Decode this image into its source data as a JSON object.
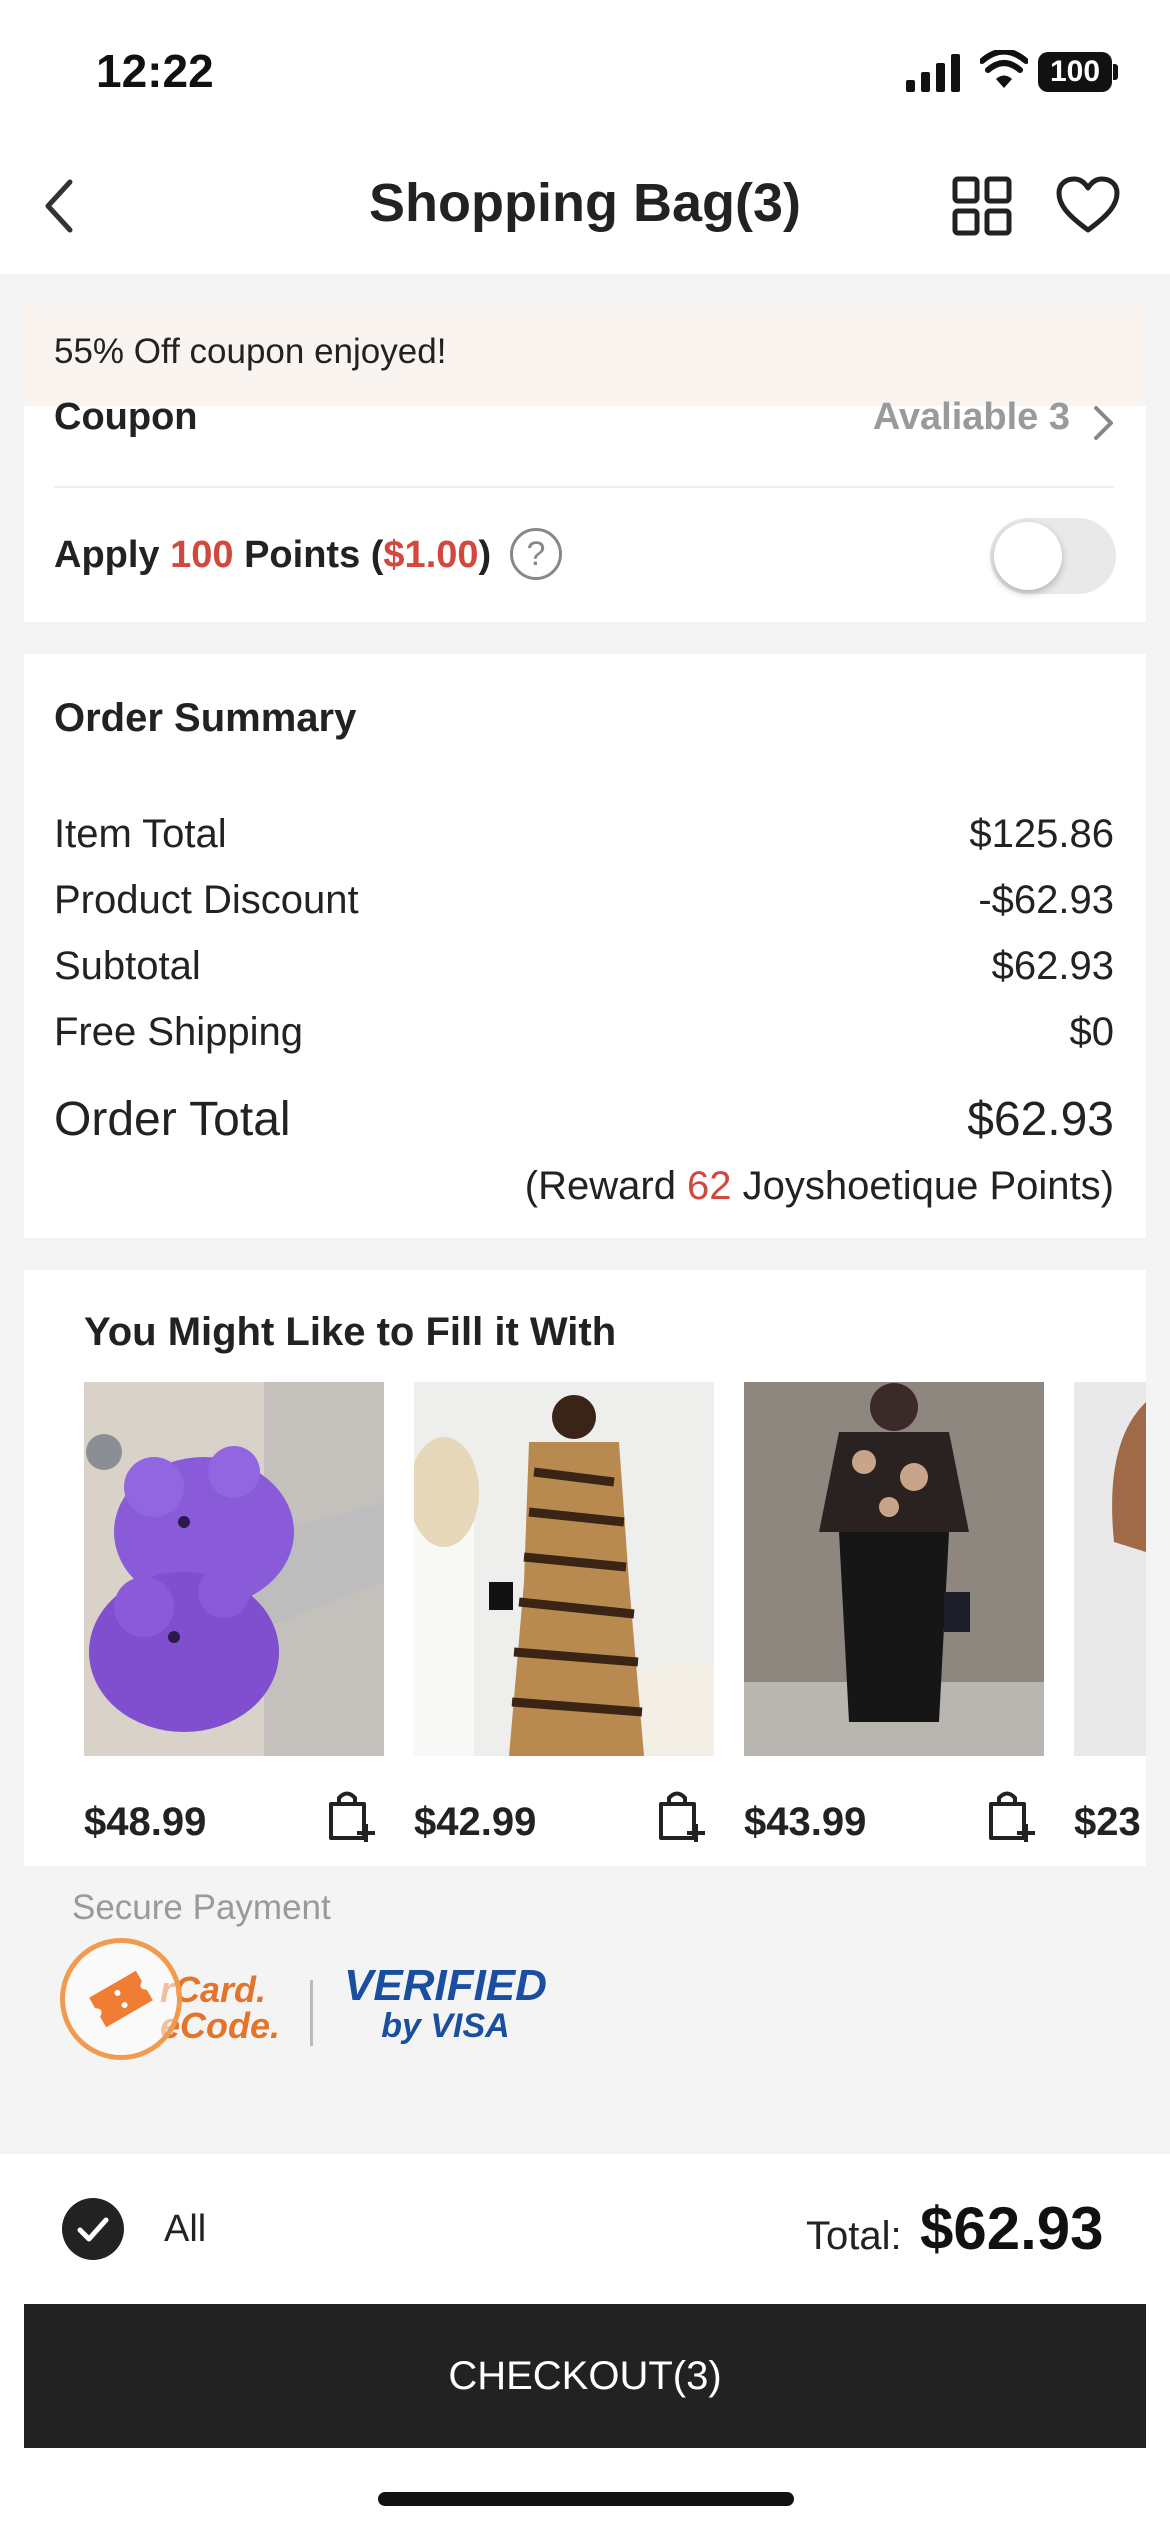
{
  "status": {
    "time": "12:22",
    "battery": "100"
  },
  "header": {
    "title": "Shopping Bag(3)"
  },
  "coupon_card": {
    "banner": "55% Off coupon enjoyed!",
    "coupon_label": "Coupon",
    "coupon_value": "Avaliable 3",
    "points": {
      "pre": "Apply ",
      "amount": "100",
      "mid": " Points (",
      "money": "$1.00",
      "post": ")"
    },
    "help": "?"
  },
  "summary": {
    "title": "Order Summary",
    "rows": [
      {
        "label": "Item Total",
        "value": "$125.86"
      },
      {
        "label": "Product Discount",
        "value": "-$62.93"
      },
      {
        "label": "Subtotal",
        "value": "$62.93"
      },
      {
        "label": "Free Shipping",
        "value": "$0"
      }
    ],
    "total_label": "Order Total",
    "total_value": "$62.93",
    "reward": {
      "pre": "(Reward ",
      "points": "62",
      "post": " Joyshoetique Points)"
    }
  },
  "suggestions": {
    "title": "You Might Like to Fill it With",
    "items": [
      {
        "price": "$48.99"
      },
      {
        "price": "$42.99"
      },
      {
        "price": "$43.99"
      },
      {
        "price": "$23"
      }
    ]
  },
  "secure": {
    "label": "Secure Payment",
    "mastercard": [
      "rCard.",
      "eCode."
    ],
    "visa": [
      "VERIFIED",
      "by VISA"
    ]
  },
  "bottom": {
    "all_label": "All",
    "total_label": "Total:",
    "total_value": "$62.93",
    "checkout_label": "CHECKOUT(3)"
  },
  "colors": {
    "accent_red": "#d2473e",
    "checkout_bg": "#222222",
    "orange": "#f29a4e"
  }
}
